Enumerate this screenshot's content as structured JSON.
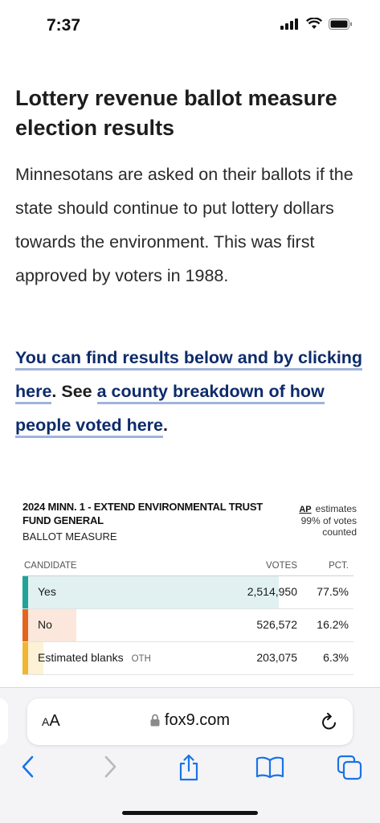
{
  "status": {
    "time": "7:37"
  },
  "article": {
    "headline": "Lottery revenue ballot measure election results",
    "intro": "Minnesotans are asked on their ballots if the state should continue to put lottery dollars towards the environment. This was first approved by voters in 1988.",
    "link1": "You can find results below and by clicking here",
    "mid": ". See ",
    "link2": "a county breakdown of how people voted here",
    "end": "."
  },
  "widget": {
    "title": "2024 MINN. 1 - EXTEND ENVIRONMENTAL TRUST FUND GENERAL",
    "subtitle": "BALLOT MEASURE",
    "ap_logo": "AP",
    "ap_line1": "estimates",
    "ap_line2": "99% of votes",
    "ap_line3": "counted",
    "headers": {
      "candidate": "CANDIDATE",
      "votes": "VOTES",
      "pct": "PCT."
    },
    "rows": [
      {
        "name": "Yes",
        "tag": "",
        "votes": "2,514,950",
        "pct": "77.5%",
        "share": 0.775,
        "color": "#1fa39a",
        "bar": "#e1f1f1"
      },
      {
        "name": "No",
        "tag": "",
        "votes": "526,572",
        "pct": "16.2%",
        "share": 0.162,
        "color": "#e3651d",
        "bar": "#fbe7dc"
      },
      {
        "name": "Estimated blanks",
        "tag": "OTH",
        "votes": "203,075",
        "pct": "6.3%",
        "share": 0.063,
        "color": "#f2b531",
        "bar": "#fdf1d6"
      }
    ]
  },
  "browser": {
    "aa_label": "AA",
    "url": "fox9.com"
  }
}
